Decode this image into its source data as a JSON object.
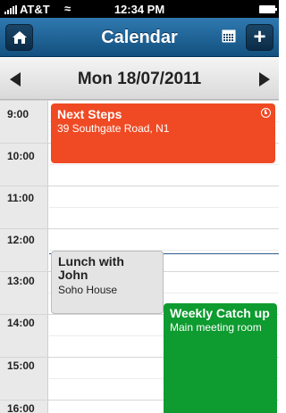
{
  "status_bar": {
    "carrier": "AT&T",
    "time": "12:34 PM"
  },
  "header": {
    "title": "Calendar",
    "home_icon": "home-icon",
    "calendar_icon": "calendar-grid-icon",
    "add_label": "+"
  },
  "date_nav": {
    "date": "Mon 18/07/2011"
  },
  "schedule": {
    "hours": [
      "9:00",
      "10:00",
      "11:00",
      "12:00",
      "13:00",
      "14:00",
      "15:00",
      "16:00"
    ],
    "events": [
      {
        "title": "Next Steps",
        "location": "39 Southgate Road, N1",
        "color": "#ef4a24",
        "has_alarm": true
      },
      {
        "title": "Lunch with John",
        "location": "Soho House",
        "color": "#e4e4e4"
      },
      {
        "title": "Weekly Catch up",
        "location": "Main meeting room",
        "color": "#0e9b2f"
      }
    ]
  },
  "colors": {
    "header": "#1f5f92",
    "now_line": "#2d5a8c"
  }
}
